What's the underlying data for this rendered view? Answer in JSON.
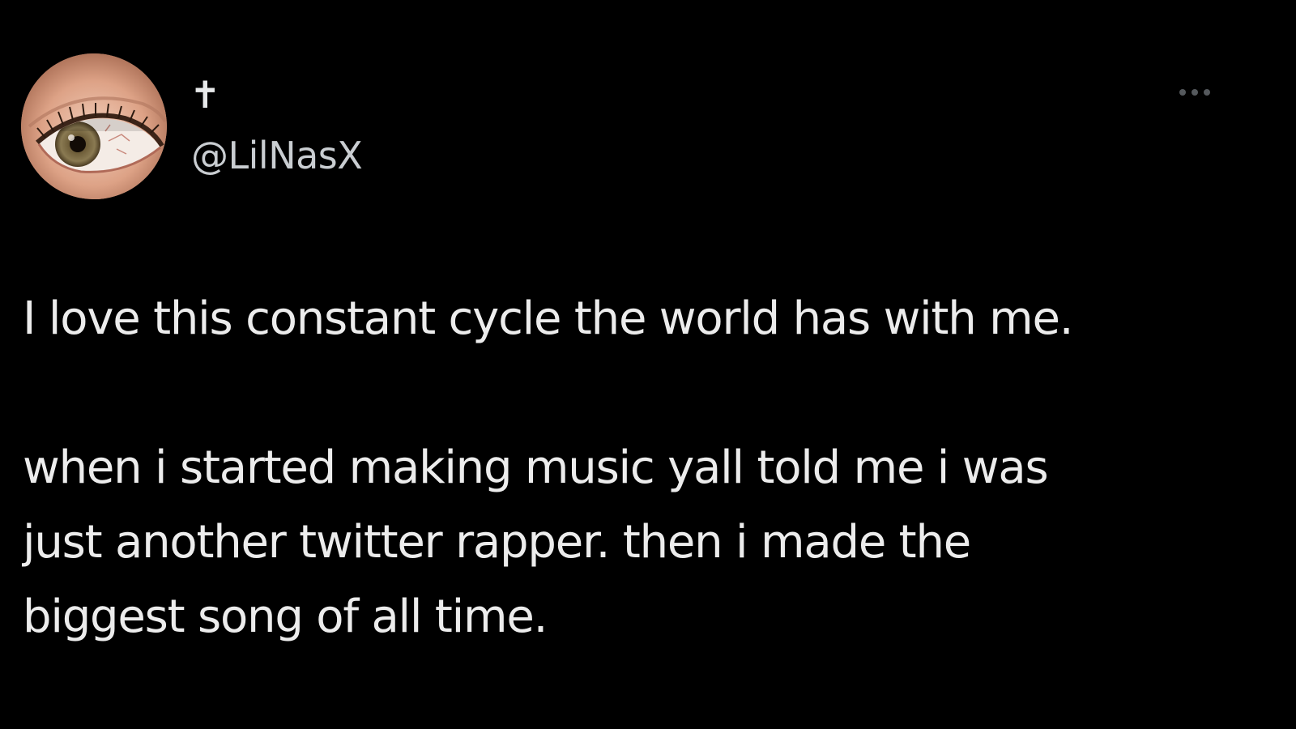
{
  "user": {
    "display_name": "✝",
    "handle": "@LilNasX",
    "avatar_icon": "eye-avatar-icon"
  },
  "more_icon": "more-horizontal-icon",
  "tweet": {
    "paragraph_1": "I love this constant cycle the world has with me.",
    "paragraph_2_lines": [
      "when i started making music yall told me i was",
      "just another twitter rapper.  then i made the",
      "biggest song of all time."
    ]
  },
  "colors": {
    "background": "#000000",
    "text_primary": "#e7e9ea",
    "text_secondary": "#c9cdd1",
    "icon_muted": "#55595d"
  }
}
